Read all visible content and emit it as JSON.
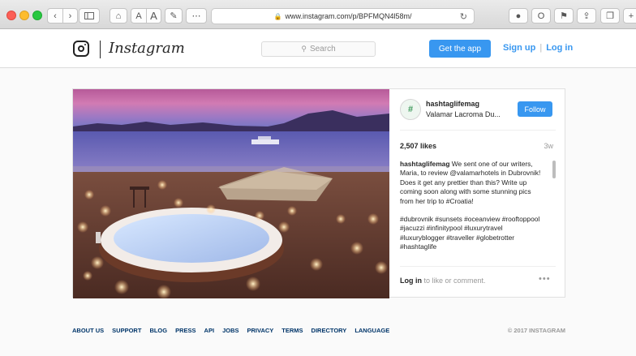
{
  "browser": {
    "url": "www.instagram.com/p/BPFMQN4l58m/",
    "text_size_labels": [
      "A",
      "A"
    ]
  },
  "header": {
    "wordmark": "Instagram",
    "search_placeholder": "Search",
    "get_app_label": "Get the app",
    "sign_up_label": "Sign up",
    "separator": "|",
    "log_in_label": "Log in"
  },
  "post": {
    "username": "hashtaglifemag",
    "location": "Valamar Lacroma Du...",
    "follow_label": "Follow",
    "likes": "2,507 likes",
    "age": "3w",
    "caption_user": "hashtaglifemag",
    "caption_text": " We sent one of our writers, Maria, to review @valamarhotels in Dubrovnik! Does it get any prettier than this? Write up coming soon along with some stunning pics from her trip to #Croatia!",
    "hashtags": "#dubrovnik #sunsets #oceanview #rooftoppool #jacuzzi #infinitypool #luxurytravel #luxuryblogger #traveller #globetrotter #hashtaglife",
    "login_link": "Log in",
    "login_rest": " to like or comment.",
    "more_label": "•••"
  },
  "footer": {
    "links": [
      "ABOUT US",
      "SUPPORT",
      "BLOG",
      "PRESS",
      "API",
      "JOBS",
      "PRIVACY",
      "TERMS",
      "DIRECTORY",
      "LANGUAGE"
    ],
    "copyright": "© 2017 INSTAGRAM"
  },
  "colors": {
    "accent": "#3897f0",
    "footer_link": "#003569"
  }
}
